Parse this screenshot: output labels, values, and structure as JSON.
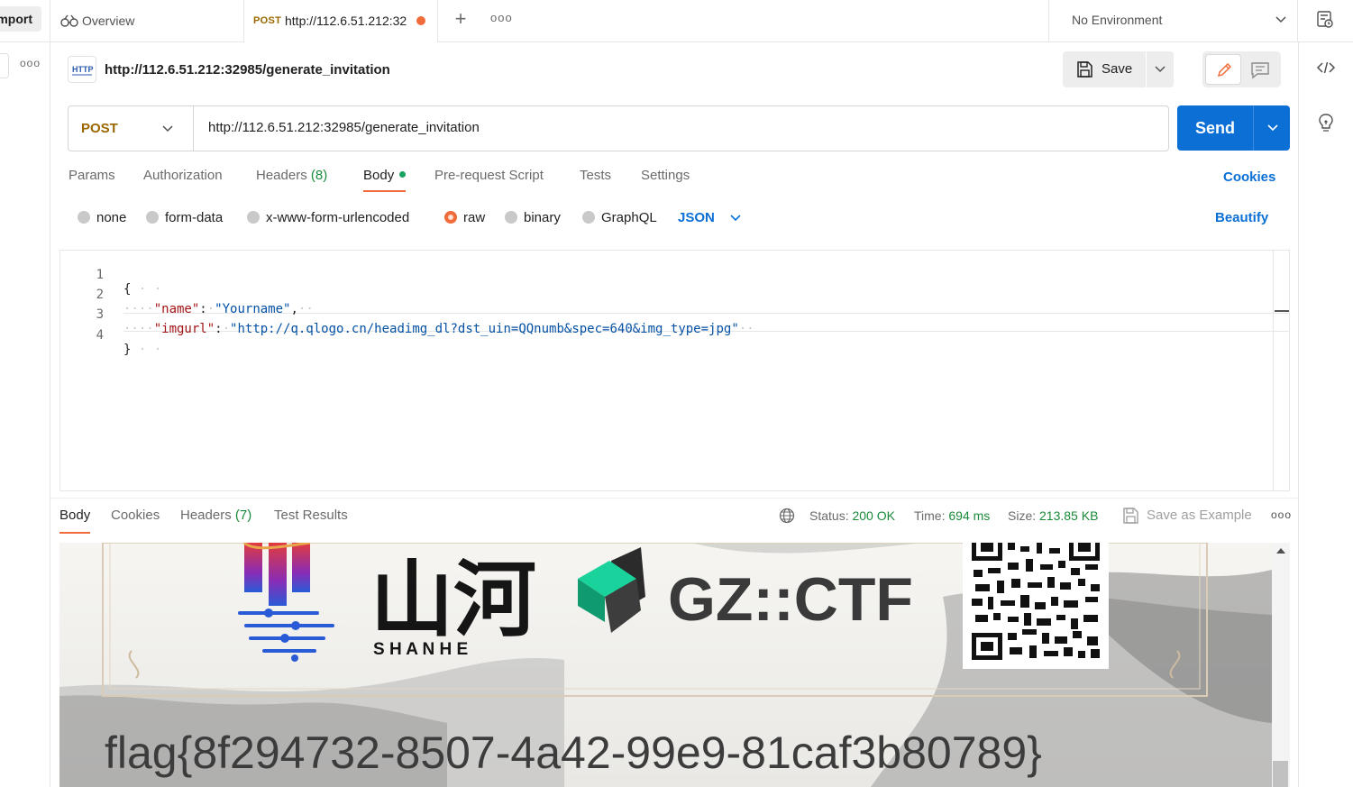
{
  "topbar": {
    "import_label": "mport",
    "overview_label": "Overview",
    "active_tab": {
      "method": "POST",
      "url": "http://112.6.51.212:32"
    },
    "environment": "No Environment"
  },
  "request": {
    "title": "http://112.6.51.212:32985/generate_invitation",
    "method": "POST",
    "url": "http://112.6.51.212:32985/generate_invitation",
    "save_label": "Save",
    "send_label": "Send",
    "tabs": [
      {
        "label": "Params"
      },
      {
        "label": "Authorization"
      },
      {
        "label": "Headers",
        "count": "(8)"
      },
      {
        "label": "Body"
      },
      {
        "label": "Pre-request Script"
      },
      {
        "label": "Tests"
      },
      {
        "label": "Settings"
      }
    ],
    "cookies_label": "Cookies",
    "body_types": [
      "none",
      "form-data",
      "x-www-form-urlencoded",
      "raw",
      "binary",
      "GraphQL"
    ],
    "selected_body_type": "raw",
    "format": "JSON",
    "beautify_label": "Beautify",
    "code": {
      "line_numbers": [
        "1",
        "2",
        "3",
        "4"
      ],
      "open_brace": "{",
      "name_key": "\"name\"",
      "name_value": "\"Yourname\"",
      "imgurl_key": "\"imgurl\"",
      "imgurl_value": "\"http://q.qlogo.cn/headimg_dl?dst_uin=QQnumb&spec=640&img_type=jpg\"",
      "close_brace": "}"
    }
  },
  "response": {
    "tabs": [
      {
        "label": "Body"
      },
      {
        "label": "Cookies"
      },
      {
        "label": "Headers",
        "count": "(7)"
      },
      {
        "label": "Test Results"
      }
    ],
    "status_label": "Status:",
    "status_value": "200 OK",
    "time_label": "Time:",
    "time_value": "694 ms",
    "size_label": "Size:",
    "size_value": "213.85 KB",
    "save_example_label": "Save as Example",
    "image": {
      "logo_chinese": "山河",
      "logo_pinyin": "S H A N H E",
      "brand": "GZ::CTF",
      "flag": "flag{8f294732-8507-4a42-99e9-81caf3b80789}"
    }
  },
  "colors": {
    "accent_orange": "#f26b3a",
    "send_blue": "#0b6fd6",
    "method_post": "#9a6700",
    "success_green": "#1a8a3a"
  },
  "icons": [
    "overview-icon",
    "plus-icon",
    "more-icon",
    "chevron-down-icon",
    "environment-icon",
    "code-icon",
    "lightbulb-icon",
    "http-icon",
    "save-icon",
    "pencil-icon",
    "comment-icon",
    "globe-icon"
  ]
}
